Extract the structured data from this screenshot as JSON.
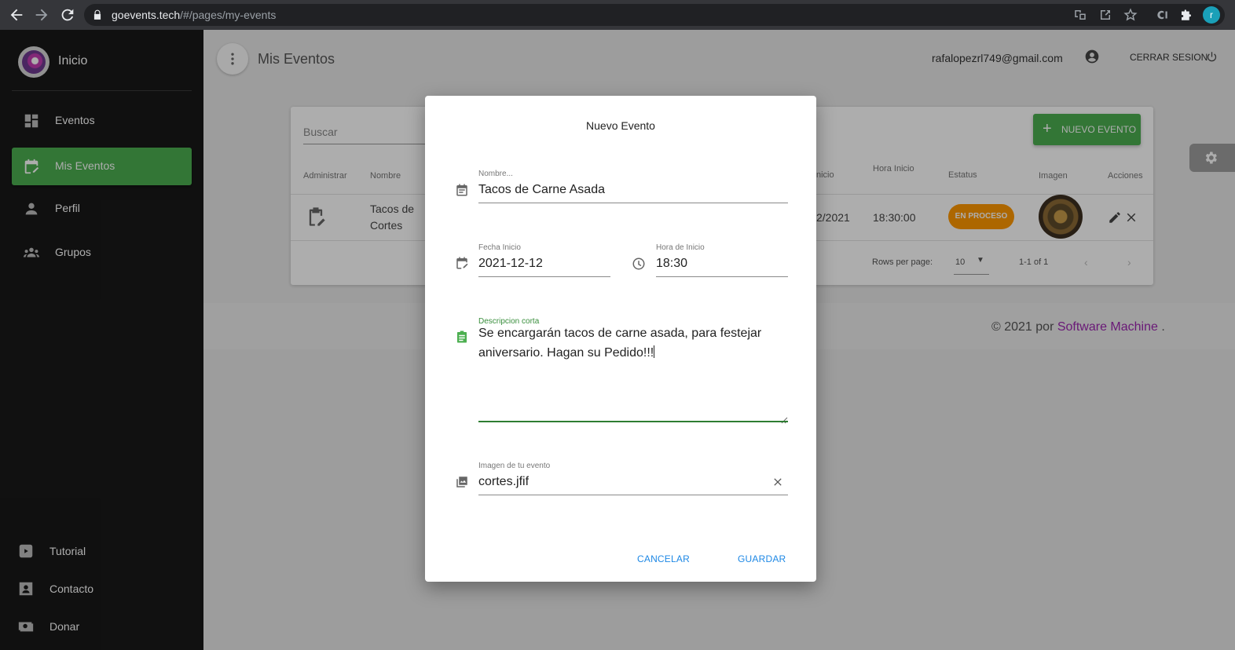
{
  "browser": {
    "url_host": "goevents.tech",
    "url_path": "/#/pages/my-events",
    "profile_initial": "r"
  },
  "sidebar": {
    "brand": "Inicio",
    "items": [
      {
        "label": "Eventos",
        "icon": "dashboard-icon",
        "active": false
      },
      {
        "label": "Mis Eventos",
        "icon": "event-edit-icon",
        "active": true
      },
      {
        "label": "Perfil",
        "icon": "person-icon",
        "active": false
      },
      {
        "label": "Grupos",
        "icon": "groups-icon",
        "active": false
      }
    ],
    "bottom_items": [
      {
        "label": "Tutorial",
        "icon": "youtube-icon"
      },
      {
        "label": "Contacto",
        "icon": "contact-card-icon"
      },
      {
        "label": "Donar",
        "icon": "donate-icon"
      }
    ]
  },
  "header": {
    "title": "Mis Eventos",
    "user_email": "rafalopezrl749@gmail.com",
    "logout_label": "CERRAR SESION"
  },
  "table": {
    "search_label": "Buscar",
    "new_button_label": "NUEVO EVENTO",
    "columns": [
      "Administrar",
      "Nombre",
      "nicio",
      "Hora Inicio",
      "Estatus",
      "Imagen",
      "Acciones"
    ],
    "row": {
      "name_line1": "Tacos de",
      "name_line2": "Cortes",
      "date_partial": "2/2021",
      "start_time": "18:30:00",
      "status": "EN PROCESO"
    },
    "pagination": {
      "rows_per_page_label": "Rows per page:",
      "rows_per_page_value": "10",
      "range": "1-1 of 1"
    }
  },
  "footer": {
    "prefix": "© 2021 por ",
    "link": "Software Machine",
    "suffix": " ."
  },
  "dialog": {
    "title": "Nuevo Evento",
    "name_label": "Nombre...",
    "name_value": "Tacos de Carne Asada",
    "date_label": "Fecha Inicio",
    "date_value": "2021-12-12",
    "time_label": "Hora de Inicio",
    "time_value": "18:30",
    "desc_label": "Descripcion corta",
    "desc_value": "Se encargarán tacos de carne asada, para festejar aniversario. Hagan su Pedido!!!",
    "image_label": "Imagen de tu evento",
    "image_value": "cortes.jfif",
    "cancel_label": "CANCELAR",
    "save_label": "GUARDAR"
  },
  "colors": {
    "accent_green": "#4caf50",
    "status_orange": "#ff9800",
    "link_purple": "#9c27b0",
    "button_blue": "#1e88e5"
  }
}
